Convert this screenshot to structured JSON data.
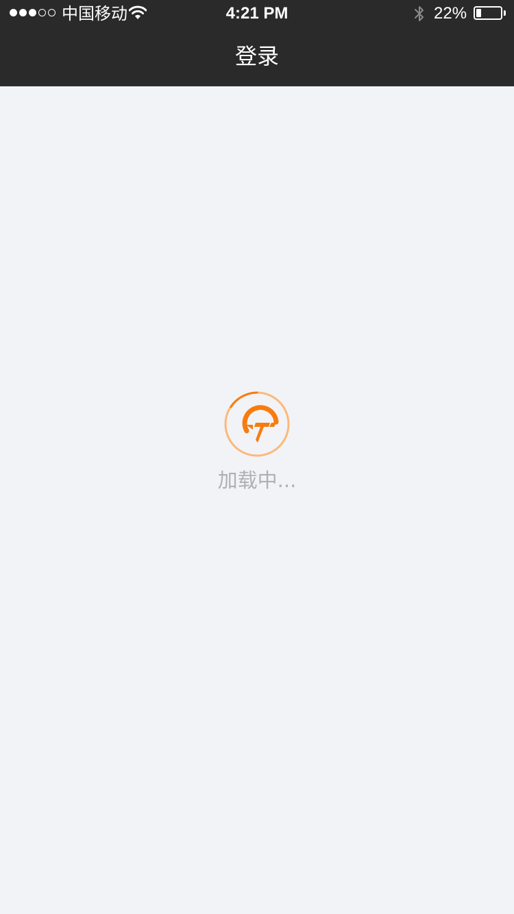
{
  "status_bar": {
    "signal_dots": [
      "full",
      "full",
      "full",
      "empty",
      "empty"
    ],
    "carrier": "中国移动",
    "time": "4:21 PM",
    "battery_percent_text": "22%",
    "battery_level": 0.22,
    "icons": {
      "wifi": "wifi-icon",
      "bluetooth": "bluetooth-icon",
      "battery": "battery-icon"
    }
  },
  "nav": {
    "title": "登录"
  },
  "loader": {
    "text": "加载中...",
    "logo": "brand-logo-icon",
    "colors": {
      "accent": "#f77c0f",
      "ring_light": "#fbb97a"
    }
  },
  "colors": {
    "topbar_bg": "#2a2a2a",
    "page_bg": "#f2f3f6",
    "loading_text": "#b0b0b4"
  }
}
